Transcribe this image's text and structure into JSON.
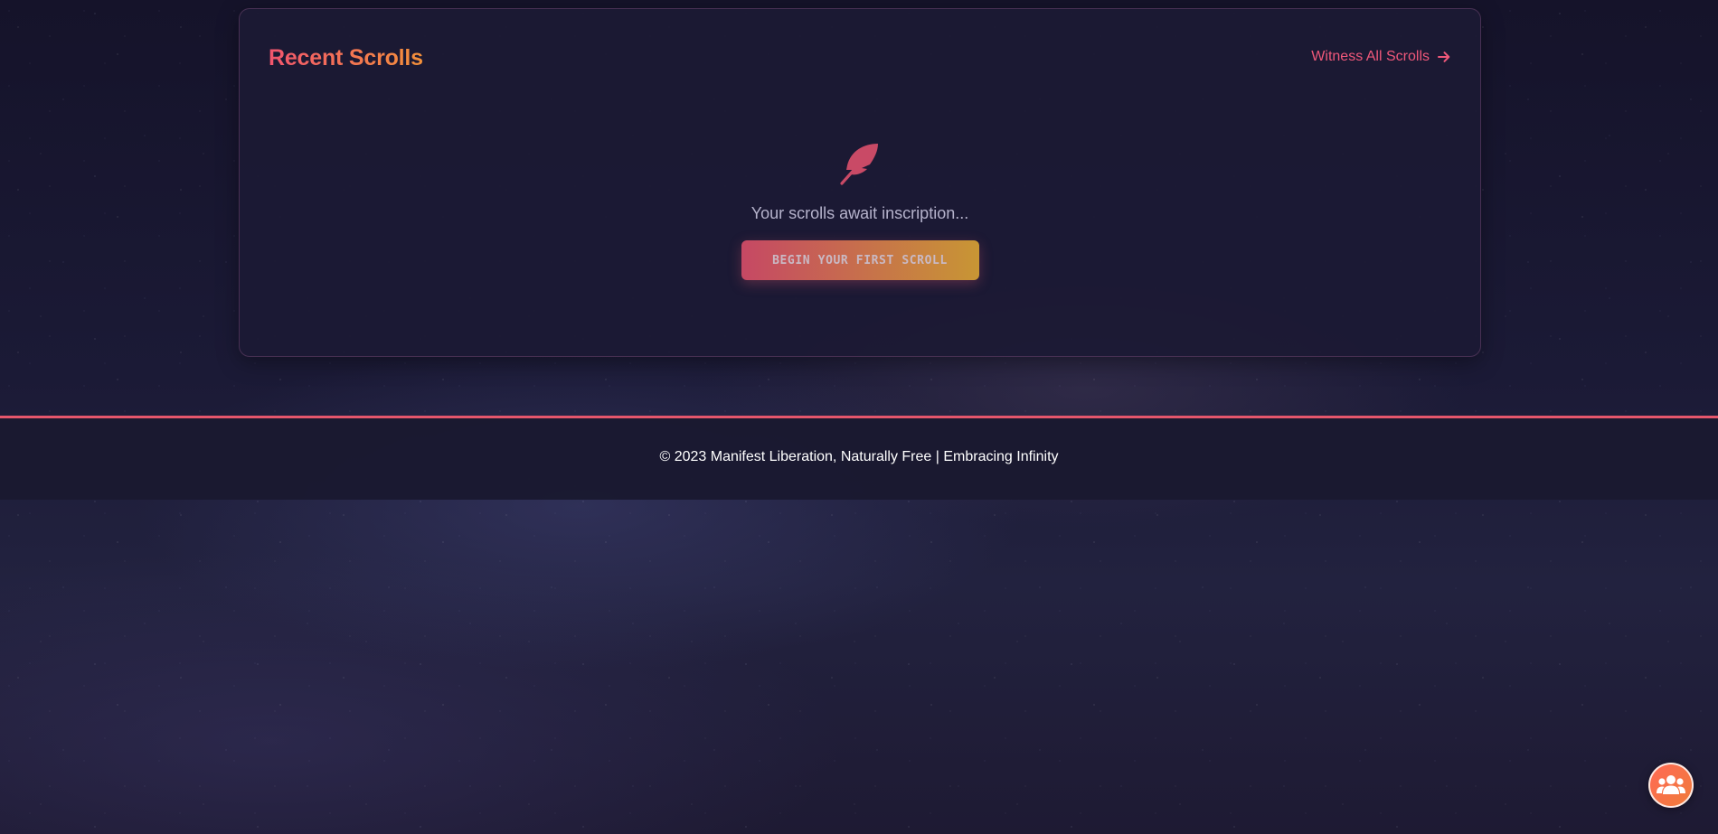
{
  "recent": {
    "title": "Recent Scrolls",
    "view_all_label": "Witness All Scrolls",
    "view_all_icon": "arrow-right-icon",
    "empty_icon": "feather-icon",
    "empty_text": "Your scrolls await inscription...",
    "cta_label": "BEGIN YOUR FIRST SCROLL"
  },
  "footer": {
    "text": "© 2023 Manifest Liberation, Naturally Free | Embracing Infinity"
  },
  "fab": {
    "icon": "users-icon"
  },
  "colors": {
    "accent_pink": "#f0587a",
    "accent_orange": "#f4913a",
    "card_bg": "#1c1a34",
    "footer_border": "#e5566c"
  }
}
